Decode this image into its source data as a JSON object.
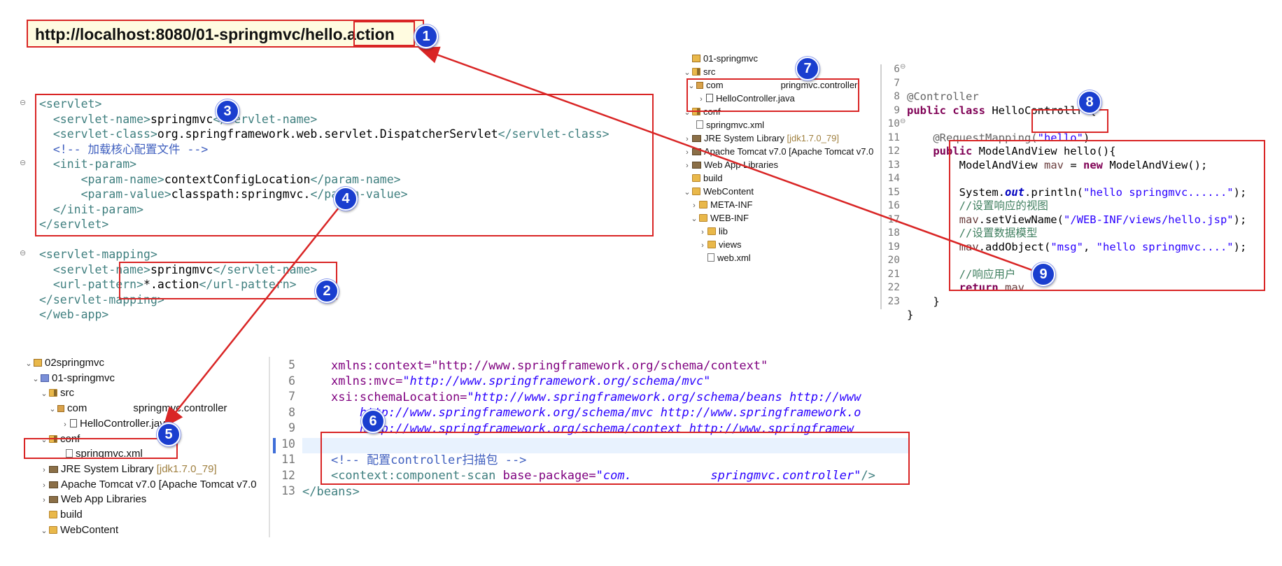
{
  "url_bar": {
    "url": "http://localhost:8080/01-springmvc/hello.action"
  },
  "badges": [
    "1",
    "2",
    "3",
    "4",
    "5",
    "6",
    "7",
    "8",
    "9"
  ],
  "webxml": {
    "lines": [
      [
        "<servlet>"
      ],
      [
        "  <servlet-name>",
        "springmvc",
        "</servlet-name>"
      ],
      [
        "  <servlet-class>",
        "org.springframework.web.servlet.DispatcherServlet",
        "</servlet-class>"
      ],
      [
        "  <!-- 加载核心配置文件 -->"
      ],
      [
        "  <init-param>"
      ],
      [
        "      <param-name>",
        "contextConfigLocation",
        "</param-name>"
      ],
      [
        "      <param-value>",
        "classpath:springmvc.",
        "</param-value>"
      ],
      [
        "  </init-param>"
      ],
      [
        "</servlet>"
      ],
      [
        ""
      ],
      [
        "<servlet-mapping>"
      ],
      [
        "  <servlet-name>",
        "springmvc",
        "</servlet-name>"
      ],
      [
        "  <url-pattern>",
        "*.action",
        "</url-pattern>"
      ],
      [
        "</servlet-mapping>"
      ],
      [
        "</web-app>"
      ]
    ]
  },
  "tree_top": {
    "items": [
      {
        "label": "01-springmvc",
        "cls": "ic-proj"
      },
      {
        "label": "src",
        "cls": "ic-src"
      },
      {
        "label": "com",
        "suffix": "pringmvc.controller",
        "cls": "ic-pkg"
      },
      {
        "label": "HelloController.java",
        "cls": "ic-java"
      },
      {
        "label": "conf",
        "cls": "ic-src"
      },
      {
        "label": "springmvc.xml",
        "cls": "ic-xml"
      },
      {
        "label": "JRE System Library",
        "muted": "[jdk1.7.0_79]",
        "cls": "ic-lib"
      },
      {
        "label": "Apache Tomcat v7.0 [Apache Tomcat v7.0",
        "cls": "ic-lib"
      },
      {
        "label": "Web App Libraries",
        "cls": "ic-lib"
      },
      {
        "label": "build",
        "cls": "ic-folder"
      },
      {
        "label": "WebContent",
        "cls": "ic-folder"
      },
      {
        "label": "META-INF",
        "cls": "ic-folder"
      },
      {
        "label": "WEB-INF",
        "cls": "ic-folder"
      },
      {
        "label": "lib",
        "cls": "ic-folder"
      },
      {
        "label": "views",
        "cls": "ic-folder"
      },
      {
        "label": "web.xml",
        "cls": "ic-xml"
      }
    ]
  },
  "java": {
    "line_numbers": [
      "6",
      "7",
      "8",
      "9",
      "10",
      "11",
      "12",
      "13",
      "14",
      "15",
      "16",
      "17",
      "18",
      "19",
      "20",
      "21",
      "22",
      "23"
    ],
    "annotation": "@Controller",
    "class_kw": "public class",
    "class_name": " HelloControll",
    "class_tail": "r {",
    "mapping": "@RequestMapping(",
    "mapping_value": "\"hello\"",
    "mapping_close": ")",
    "method_kw": "public",
    "method_sig": " ModelAndView hello(){",
    "l12a": "ModelAndView ",
    "l12b": "mav",
    "l12c": " = ",
    "l12d": "new",
    "l12e": " ModelAndView();",
    "l14a": "System.",
    "l14b": "out",
    "l14c": ".println(",
    "l14d": "\"hello springmvc......\"",
    "l14e": ");",
    "l15": "//设置响应的视图",
    "l16a": "mav",
    "l16b": ".setViewName(",
    "l16c": "\"/WEB-INF/views/hello.jsp\"",
    "l16d": ");",
    "l17": "//设置数据模型",
    "l18a": "mav",
    "l18b": ".addObject(",
    "l18c": "\"msg\"",
    "l18d": ", ",
    "l18e": "\"hello springmvc....\"",
    "l18f": ");",
    "l20": "//响应用户",
    "l21a": "return",
    "l21b": " mav",
    "l22": "}",
    "l23": "}"
  },
  "tree_bottom": {
    "items": [
      {
        "label": "02springmvc",
        "cls": "ic-proj"
      },
      {
        "label": "01-springmvc",
        "cls": "ic-web"
      },
      {
        "label": "src",
        "cls": "ic-src"
      },
      {
        "label": "com",
        "suffix": "springmvc.controller",
        "cls": "ic-pkg"
      },
      {
        "label": "HelloController.java",
        "cls": "ic-java"
      },
      {
        "label": "conf",
        "cls": "ic-src"
      },
      {
        "label": "springmvc.xml",
        "cls": "ic-xml"
      },
      {
        "label": "JRE System Library",
        "muted": "[jdk1.7.0_79]",
        "cls": "ic-lib"
      },
      {
        "label": "Apache Tomcat v7.0 [Apache Tomcat v7.0",
        "cls": "ic-lib"
      },
      {
        "label": "Web App Libraries",
        "cls": "ic-lib"
      },
      {
        "label": "build",
        "cls": "ic-folder"
      },
      {
        "label": "WebContent",
        "cls": "ic-folder"
      }
    ]
  },
  "springxml": {
    "line_numbers": [
      "5",
      "6",
      "7",
      "8",
      "9",
      "10",
      "11",
      "12",
      "13"
    ],
    "l4": "xmlns:context=\"http://www.springframework.org/schema/context\"",
    "l5a": "xmlns:mvc=",
    "l5b": "\"http://www.springframework.org/schema/mvc\"",
    "l6a": "xsi:schemaLocation=",
    "l6b": "\"http://www.springframework.org/schema/beans http://www",
    "l7": "    http://www.springframework.org/schema/mvc http://www.springframework.o",
    "l8": "    http://www.springframework.org/schema/context http://www.springframew",
    "l10": "<!-- 配置controller扫描包 -->",
    "l11a": "<context:component-scan ",
    "l11b": "base-package=",
    "l11c": "\"com.",
    "l11d": "springmvc.controller\"",
    "l11e": "/>",
    "l12": "</beans>"
  },
  "colors": {
    "annotation_red": "#d92525",
    "badge_blue": "#1a3ecf"
  }
}
